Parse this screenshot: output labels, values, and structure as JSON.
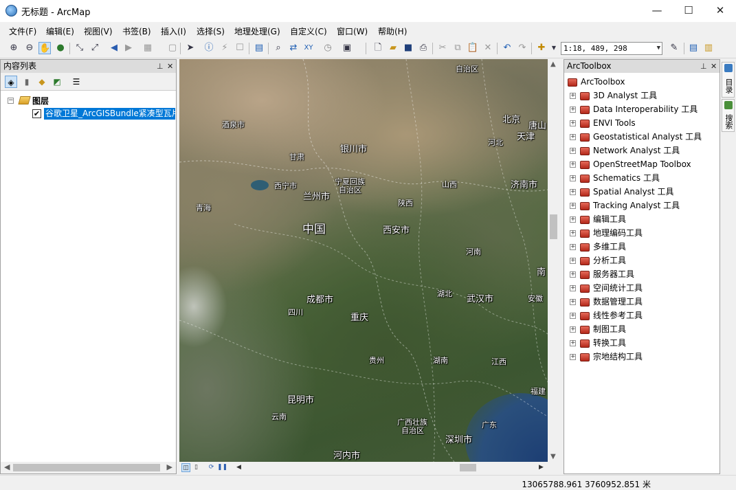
{
  "window": {
    "title": "无标题 - ArcMap",
    "minimize": "—",
    "maximize": "☐",
    "close": "✕"
  },
  "menu": [
    "文件(F)",
    "编辑(E)",
    "视图(V)",
    "书签(B)",
    "插入(I)",
    "选择(S)",
    "地理处理(G)",
    "自定义(C)",
    "窗口(W)",
    "帮助(H)"
  ],
  "toolbar": {
    "scale": "1:18, 489, 298"
  },
  "toc": {
    "title": "内容列表",
    "root_label": "图层",
    "layer_name": "谷歌卫星_ArcGISBundle紧凑型瓦片"
  },
  "map": {
    "labels": [
      {
        "text": "自治区",
        "type": "region"
      },
      {
        "text": "酒泉市",
        "type": "region"
      },
      {
        "text": "银川市",
        "type": "city"
      },
      {
        "text": "北京",
        "type": "city"
      },
      {
        "text": "唐山",
        "type": "city"
      },
      {
        "text": "天津",
        "type": "city"
      },
      {
        "text": "河北",
        "type": "region"
      },
      {
        "text": "甘肃",
        "type": "region"
      },
      {
        "text": "宁夏回族",
        "type": "region"
      },
      {
        "text": "自治区",
        "type": "region"
      },
      {
        "text": "西宁市",
        "type": "region"
      },
      {
        "text": "兰州市",
        "type": "city"
      },
      {
        "text": "山西",
        "type": "region"
      },
      {
        "text": "济南市",
        "type": "city"
      },
      {
        "text": "青海",
        "type": "region"
      },
      {
        "text": "陕西",
        "type": "region"
      },
      {
        "text": "中国",
        "type": "country"
      },
      {
        "text": "西安市",
        "type": "city"
      },
      {
        "text": "河南",
        "type": "region"
      },
      {
        "text": "南",
        "type": "city"
      },
      {
        "text": "成都市",
        "type": "city"
      },
      {
        "text": "湖北",
        "type": "region"
      },
      {
        "text": "武汉市",
        "type": "city"
      },
      {
        "text": "安徽",
        "type": "region"
      },
      {
        "text": "四川",
        "type": "region"
      },
      {
        "text": "重庆",
        "type": "city"
      },
      {
        "text": "贵州",
        "type": "region"
      },
      {
        "text": "湖南",
        "type": "region"
      },
      {
        "text": "江西",
        "type": "region"
      },
      {
        "text": "昆明市",
        "type": "city"
      },
      {
        "text": "福建",
        "type": "region"
      },
      {
        "text": "云南",
        "type": "region"
      },
      {
        "text": "广西壮族",
        "type": "region"
      },
      {
        "text": "自治区",
        "type": "region"
      },
      {
        "text": "广东",
        "type": "region"
      },
      {
        "text": "深圳市",
        "type": "city"
      },
      {
        "text": "河内市",
        "type": "city"
      }
    ]
  },
  "arctoolbox": {
    "title": "ArcToolbox",
    "root": "ArcToolbox",
    "items": [
      "3D Analyst 工具",
      "Data Interoperability 工具",
      "ENVI Tools",
      "Geostatistical Analyst 工具",
      "Network Analyst 工具",
      "OpenStreetMap Toolbox",
      "Schematics 工具",
      "Spatial Analyst 工具",
      "Tracking Analyst 工具",
      "编辑工具",
      "地理编码工具",
      "多维工具",
      "分析工具",
      "服务器工具",
      "空间统计工具",
      "数据管理工具",
      "线性参考工具",
      "制图工具",
      "转换工具",
      "宗地结构工具"
    ]
  },
  "side_tabs": [
    "目录",
    "搜索"
  ],
  "status": {
    "coordinates": "13065788.961  3760952.851 米"
  }
}
